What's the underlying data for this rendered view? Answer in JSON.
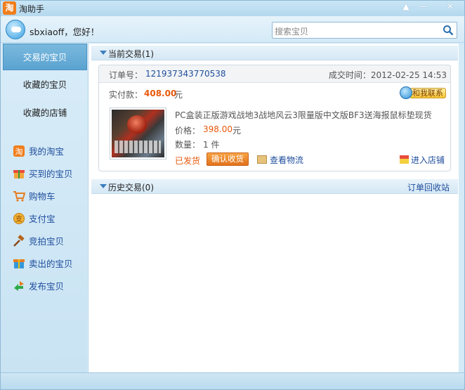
{
  "window": {
    "app_icon_char": "淘",
    "title": "淘助手",
    "controls": {
      "pin": "▲",
      "minimize": "—",
      "close": "✕"
    }
  },
  "user": {
    "greeting": "sbxiaoff，您好！"
  },
  "search": {
    "placeholder": "搜索宝贝"
  },
  "sidebar": {
    "tabs": [
      {
        "label": "交易的宝贝",
        "active": true
      },
      {
        "label": "收藏的宝贝",
        "active": false
      },
      {
        "label": "收藏的店铺",
        "active": false
      }
    ],
    "links": [
      {
        "label": "我的淘宝",
        "icon": "taobao-icon"
      },
      {
        "label": "买到的宝贝",
        "icon": "gift-icon"
      },
      {
        "label": "购物车",
        "icon": "cart-icon"
      },
      {
        "label": "支付宝",
        "icon": "alipay-icon"
      },
      {
        "label": "竞拍宝贝",
        "icon": "gavel-icon"
      },
      {
        "label": "卖出的宝贝",
        "icon": "package-icon"
      },
      {
        "label": "发布宝贝",
        "icon": "publish-icon"
      }
    ]
  },
  "current_trades": {
    "header": "当前交易(1)",
    "order": {
      "order_no_label": "订单号：",
      "order_no": "121937343770538",
      "time_label": "成交时间：",
      "time": "2012-02-25 14:53",
      "paid_label": "实付款：",
      "paid_amount": "408.00",
      "paid_unit": "元",
      "contact_label": "和我联系",
      "item_title": "PC盒装正版游戏战地3战地风云3限量版中文版BF3送海报鼠标垫现货",
      "price_label": "价格：",
      "price": "398.00",
      "price_unit": "元",
      "qty_label": "数量：",
      "qty": "1 件",
      "status": "已发货",
      "confirm_label": "确认收货",
      "logistics_label": "查看物流",
      "shop_label": "进入店铺"
    }
  },
  "history_trades": {
    "header": "历史交易(0)",
    "recycle_label": "订单回收站"
  },
  "colors": {
    "accent_orange": "#e8590c",
    "link_blue": "#1f4e9c",
    "active_tab": "#5aa3d1"
  }
}
